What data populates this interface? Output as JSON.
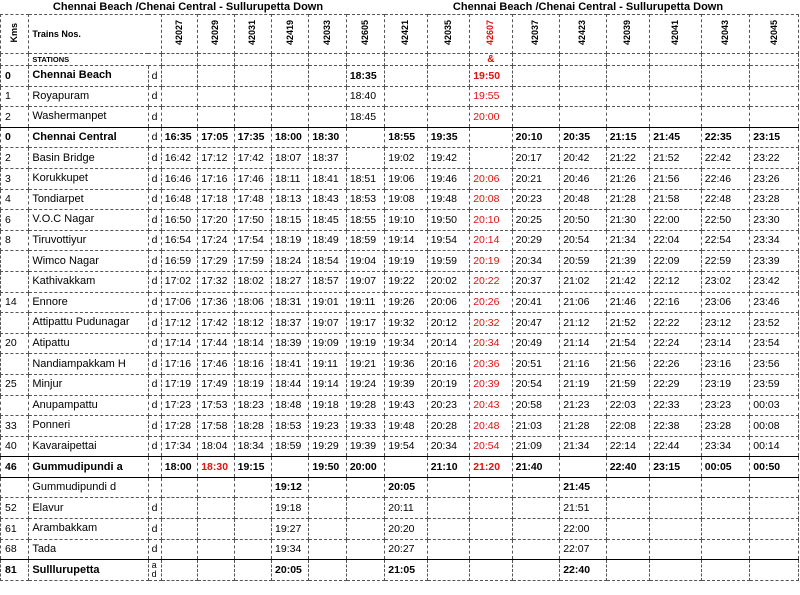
{
  "title_left": "Chennai Beach /Chenai Central - Sullurupetta    Down",
  "title_right": "Chennai Beach /Chenai Central - Sullurupetta    Down",
  "header": {
    "kms": "Kms",
    "trains_label": "Trains Nos.",
    "stations_label": "STATIONS"
  },
  "trains": [
    "42027",
    "42029",
    "42031",
    "42419",
    "42033",
    "42605",
    "42421",
    "42035",
    "42607",
    "42037",
    "42423",
    "42039",
    "42041",
    "42043",
    "42045"
  ],
  "red_train_index": 8,
  "red_train_mark": "&",
  "rows": [
    {
      "km": "0",
      "station": "Chennai Beach",
      "ad": "d",
      "bold": true,
      "times": [
        "",
        "",
        "",
        "",
        "",
        "18:35",
        "",
        "",
        "19:50",
        "",
        "",
        "",
        "",
        "",
        ""
      ]
    },
    {
      "km": "1",
      "station": "Royapuram",
      "ad": "d",
      "bold": false,
      "times": [
        "",
        "",
        "",
        "",
        "",
        "18:40",
        "",
        "",
        "19:55",
        "",
        "",
        "",
        "",
        "",
        ""
      ]
    },
    {
      "km": "2",
      "station": "Washermanpet",
      "ad": "d",
      "bold": false,
      "times": [
        "",
        "",
        "",
        "",
        "",
        "18:45",
        "",
        "",
        "20:00",
        "",
        "",
        "",
        "",
        "",
        ""
      ]
    },
    {
      "km": "0",
      "station": "Chennai Central",
      "ad": "d",
      "bold": true,
      "times": [
        "16:35",
        "17:05",
        "17:35",
        "18:00",
        "18:30",
        "",
        "18:55",
        "19:35",
        "",
        "20:10",
        "20:35",
        "21:15",
        "21:45",
        "22:35",
        "23:15"
      ]
    },
    {
      "km": "2",
      "station": "Basin Bridge",
      "ad": "d",
      "bold": false,
      "times": [
        "16:42",
        "17:12",
        "17:42",
        "18:07",
        "18:37",
        "",
        "19:02",
        "19:42",
        "",
        "20:17",
        "20:42",
        "21:22",
        "21:52",
        "22:42",
        "23:22"
      ]
    },
    {
      "km": "3",
      "station": "Korukkupet",
      "ad": "d",
      "bold": false,
      "times": [
        "16:46",
        "17:16",
        "17:46",
        "18:11",
        "18:41",
        "18:51",
        "19:06",
        "19:46",
        "20:06",
        "20:21",
        "20:46",
        "21:26",
        "21:56",
        "22:46",
        "23:26"
      ]
    },
    {
      "km": "4",
      "station": "Tondiarpet",
      "ad": "d",
      "bold": false,
      "times": [
        "16:48",
        "17:18",
        "17:48",
        "18:13",
        "18:43",
        "18:53",
        "19:08",
        "19:48",
        "20:08",
        "20:23",
        "20:48",
        "21:28",
        "21:58",
        "22:48",
        "23:28"
      ]
    },
    {
      "km": "6",
      "station": "V.O.C Nagar",
      "ad": "d",
      "bold": false,
      "times": [
        "16:50",
        "17:20",
        "17:50",
        "18:15",
        "18:45",
        "18:55",
        "19:10",
        "19:50",
        "20:10",
        "20:25",
        "20:50",
        "21:30",
        "22:00",
        "22:50",
        "23:30"
      ]
    },
    {
      "km": "8",
      "station": "Tiruvottiyur",
      "ad": "d",
      "bold": false,
      "times": [
        "16:54",
        "17:24",
        "17:54",
        "18:19",
        "18:49",
        "18:59",
        "19:14",
        "19:54",
        "20:14",
        "20:29",
        "20:54",
        "21:34",
        "22:04",
        "22:54",
        "23:34"
      ]
    },
    {
      "km": "",
      "station": "Wimco Nagar",
      "ad": "d",
      "bold": false,
      "times": [
        "16:59",
        "17:29",
        "17:59",
        "18:24",
        "18:54",
        "19:04",
        "19:19",
        "19:59",
        "20:19",
        "20:34",
        "20:59",
        "21:39",
        "22:09",
        "22:59",
        "23:39"
      ]
    },
    {
      "km": "",
      "station": "Kathivakkam",
      "ad": "d",
      "bold": false,
      "times": [
        "17:02",
        "17:32",
        "18:02",
        "18:27",
        "18:57",
        "19:07",
        "19:22",
        "20:02",
        "20:22",
        "20:37",
        "21:02",
        "21:42",
        "22:12",
        "23:02",
        "23:42"
      ]
    },
    {
      "km": "14",
      "station": "Ennore",
      "ad": "d",
      "bold": false,
      "times": [
        "17:06",
        "17:36",
        "18:06",
        "18:31",
        "19:01",
        "19:11",
        "19:26",
        "20:06",
        "20:26",
        "20:41",
        "21:06",
        "21:46",
        "22:16",
        "23:06",
        "23:46"
      ]
    },
    {
      "km": "",
      "station": "Attipattu Pudunagar",
      "ad": "d",
      "bold": false,
      "times": [
        "17:12",
        "17:42",
        "18:12",
        "18:37",
        "19:07",
        "19:17",
        "19:32",
        "20:12",
        "20:32",
        "20:47",
        "21:12",
        "21:52",
        "22:22",
        "23:12",
        "23:52"
      ]
    },
    {
      "km": "20",
      "station": "Atipattu",
      "ad": "d",
      "bold": false,
      "times": [
        "17:14",
        "17:44",
        "18:14",
        "18:39",
        "19:09",
        "19:19",
        "19:34",
        "20:14",
        "20:34",
        "20:49",
        "21:14",
        "21:54",
        "22:24",
        "23:14",
        "23:54"
      ]
    },
    {
      "km": "",
      "station": "Nandiampakkam H",
      "ad": "d",
      "bold": false,
      "times": [
        "17:16",
        "17:46",
        "18:16",
        "18:41",
        "19:11",
        "19:21",
        "19:36",
        "20:16",
        "20:36",
        "20:51",
        "21:16",
        "21:56",
        "22:26",
        "23:16",
        "23:56"
      ]
    },
    {
      "km": "25",
      "station": "Minjur",
      "ad": "d",
      "bold": false,
      "times": [
        "17:19",
        "17:49",
        "18:19",
        "18:44",
        "19:14",
        "19:24",
        "19:39",
        "20:19",
        "20:39",
        "20:54",
        "21:19",
        "21:59",
        "22:29",
        "23:19",
        "23:59"
      ]
    },
    {
      "km": "",
      "station": "Anupampattu",
      "ad": "d",
      "bold": false,
      "times": [
        "17:23",
        "17:53",
        "18:23",
        "18:48",
        "19:18",
        "19:28",
        "19:43",
        "20:23",
        "20:43",
        "20:58",
        "21:23",
        "22:03",
        "22:33",
        "23:23",
        "00:03"
      ]
    },
    {
      "km": "33",
      "station": "Ponneri",
      "ad": "d",
      "bold": false,
      "times": [
        "17:28",
        "17:58",
        "18:28",
        "18:53",
        "19:23",
        "19:33",
        "19:48",
        "20:28",
        "20:48",
        "21:03",
        "21:28",
        "22:08",
        "22:38",
        "23:28",
        "00:08"
      ]
    },
    {
      "km": "40",
      "station": "Kavaraipettai",
      "ad": "d",
      "bold": false,
      "times": [
        "17:34",
        "18:04",
        "18:34",
        "18:59",
        "19:29",
        "19:39",
        "19:54",
        "20:34",
        "20:54",
        "21:09",
        "21:34",
        "22:14",
        "22:44",
        "23:34",
        "00:14"
      ]
    },
    {
      "km": "46",
      "station": "Gummudipundi   a",
      "ad": "",
      "bold": true,
      "times": [
        "18:00",
        "18:30",
        "19:15",
        "",
        "19:50",
        "20:00",
        "",
        "21:10",
        "21:20",
        "21:40",
        "",
        "22:40",
        "23:15",
        "00:05",
        "00:50"
      ]
    },
    {
      "km": "",
      "station": "Gummudipundi   d",
      "ad": "",
      "bold": false,
      "times": [
        "",
        "",
        "",
        "19:12",
        "",
        "",
        "20:05",
        "",
        "",
        "",
        "21:45",
        "",
        "",
        "",
        ""
      ]
    },
    {
      "km": "52",
      "station": "Elavur",
      "ad": "d",
      "bold": false,
      "times": [
        "",
        "",
        "",
        "19:18",
        "",
        "",
        "20:11",
        "",
        "",
        "",
        "21:51",
        "",
        "",
        "",
        ""
      ]
    },
    {
      "km": "61",
      "station": "Arambakkam",
      "ad": "d",
      "bold": false,
      "times": [
        "",
        "",
        "",
        "19:27",
        "",
        "",
        "20:20",
        "",
        "",
        "",
        "22:00",
        "",
        "",
        "",
        ""
      ]
    },
    {
      "km": "68",
      "station": "Tada",
      "ad": "d",
      "bold": false,
      "times": [
        "",
        "",
        "",
        "19:34",
        "",
        "",
        "20:27",
        "",
        "",
        "",
        "22:07",
        "",
        "",
        "",
        ""
      ]
    },
    {
      "km": "81",
      "station": "Sulllurupetta",
      "ad": "a\nd",
      "bold": true,
      "times": [
        "",
        "",
        "",
        "20:05",
        "",
        "",
        "21:05",
        "",
        "",
        "",
        "22:40",
        "",
        "",
        "",
        ""
      ]
    }
  ],
  "bold_times": {
    "0": [
      5,
      8
    ],
    "3": [
      0,
      1,
      2,
      3,
      4,
      6,
      7,
      9,
      10,
      11,
      12,
      13,
      14
    ],
    "19": [
      0,
      1,
      2,
      4,
      5,
      7,
      8,
      9,
      11,
      12,
      13,
      14
    ],
    "20": [
      3,
      6,
      10
    ],
    "24": [
      3,
      6,
      10
    ]
  },
  "red_cells": {
    "19": [
      1
    ]
  }
}
